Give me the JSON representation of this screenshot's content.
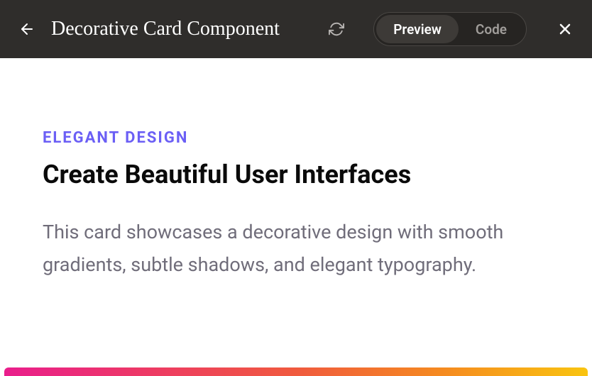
{
  "header": {
    "title": "Decorative Card Component",
    "toggle": {
      "preview": "Preview",
      "code": "Code"
    }
  },
  "card": {
    "eyebrow": "ELEGANT DESIGN",
    "title": "Create Beautiful User Interfaces",
    "body": "This card showcases a decorative design with smooth gradients, subtle shadows, and elegant typography."
  }
}
